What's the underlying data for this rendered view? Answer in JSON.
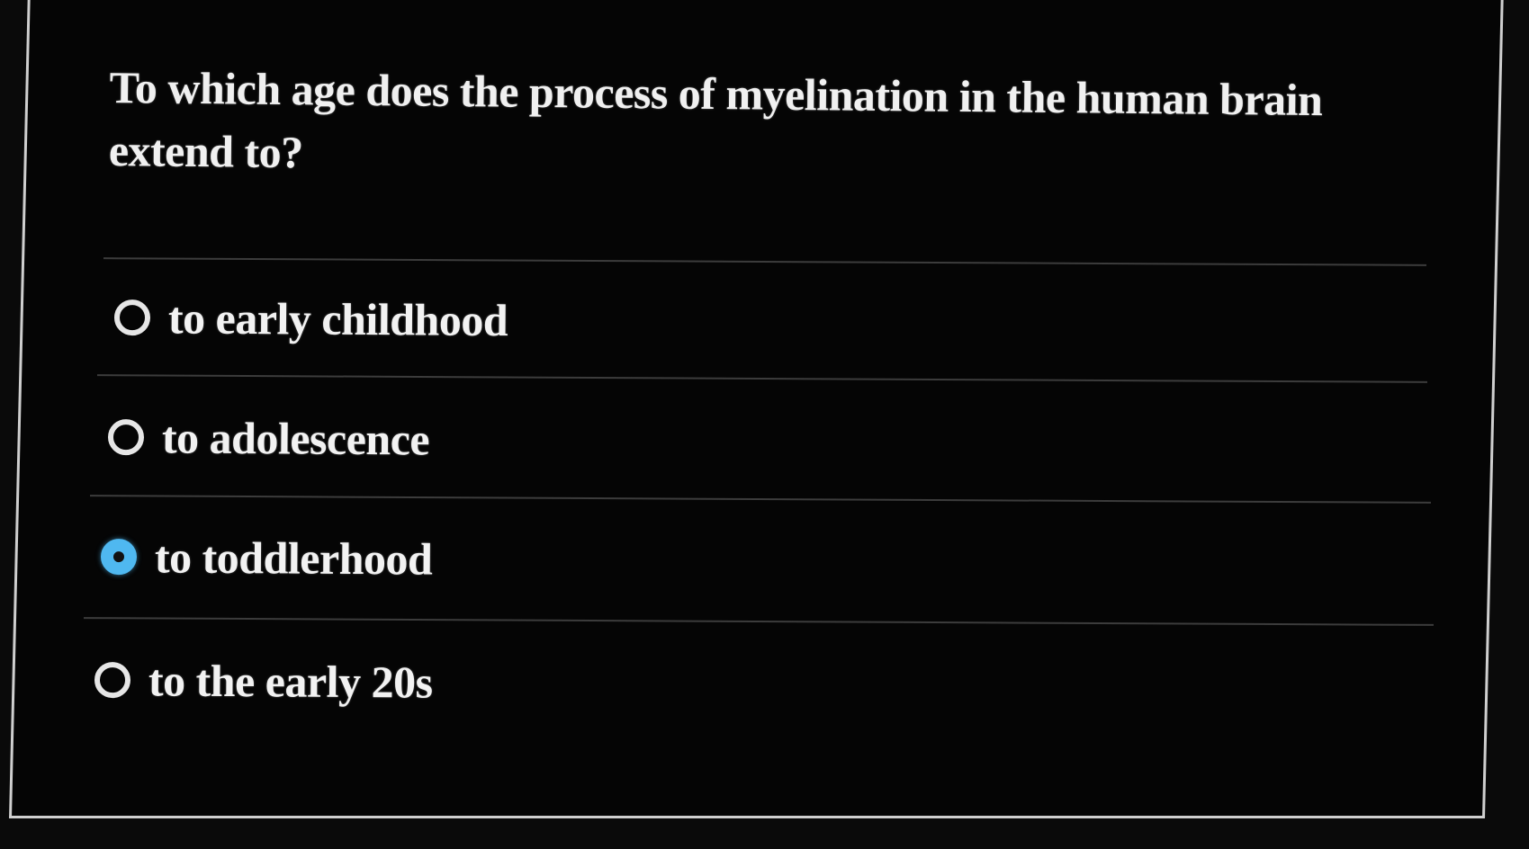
{
  "question": {
    "text": "To which age does the process of myelination in the human brain extend to?"
  },
  "options": [
    {
      "label": "to early childhood",
      "selected": false
    },
    {
      "label": "to adolescence",
      "selected": false
    },
    {
      "label": "to toddlerhood",
      "selected": true
    },
    {
      "label": "to the early 20s",
      "selected": false
    }
  ],
  "colors": {
    "background": "#050505",
    "text": "#f0f0f0",
    "selected_accent": "#4fb8f0",
    "divider": "#3c3c3c"
  }
}
